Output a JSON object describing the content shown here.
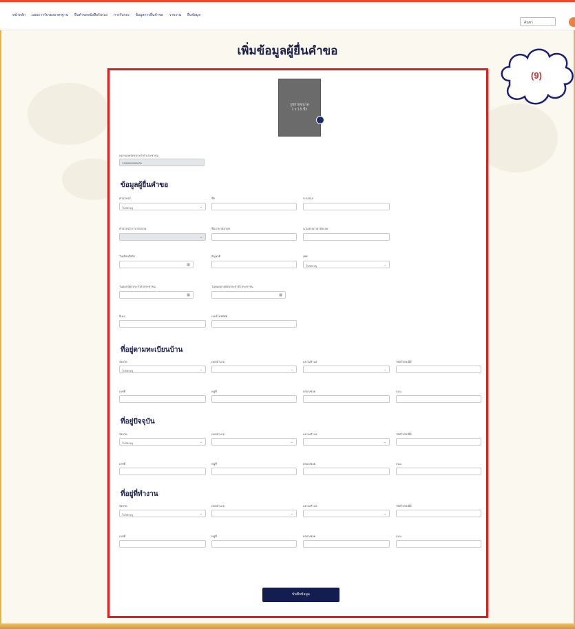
{
  "nav": {
    "items": [
      "หน้าหลัก",
      "แผนการรับรองมาตรฐาน",
      "ยื่นคำขอหนังสือรับรอง",
      "การรับรอง",
      "ข้อมูลการยื่นคำขอ",
      "รายงาน",
      "ยื่นข้อมูล"
    ],
    "search_placeholder": "ค้นหา"
  },
  "page_title": "เพิ่มข้อมูลผู้ยื่นคำขอ",
  "annotation_label": "(9)",
  "photo": {
    "caption_line1": "รูปถ่ายขนาด",
    "caption_line2": "1 x 1.5 นิ้ว"
  },
  "id_field": {
    "label": "หมายเลขบัตรประจำตัวประชาชน",
    "value": "1330000000000"
  },
  "applicant": {
    "title": "ข้อมูลผู้ยื่นคำขอ",
    "prefix_label": "คำนำหน้า",
    "prefix_value": "โปรดระบุ",
    "firstname_label": "ชื่อ",
    "lastname_label": "นามสกุล",
    "prefix_en_label": "คำนำหน้าภาษาอังกฤษ",
    "firstname_en_label": "ชื่อภาษาอังกฤษ",
    "lastname_en_label": "นามสกุลภาษาอังกฤษ",
    "birthdate_label": "วันเดือนปีเกิด",
    "nationality_label": "สัญชาติ",
    "gender_label": "เพศ",
    "gender_value": "โปรดระบุ",
    "issue_date_label": "วันออกบัตรประจำตัวประชาชน",
    "expire_date_label": "วันหมดอายุบัตรประจำตัวประชาชน",
    "email_label": "อีเมล",
    "phone_label": "เบอร์โทรศัพท์"
  },
  "addresses": [
    {
      "title": "ที่อยู่ตามทะเบียนบ้าน"
    },
    {
      "title": "ที่อยู่ปัจจุบัน"
    },
    {
      "title": "ที่อยู่ที่ทำงาน"
    }
  ],
  "address_fields": {
    "province_label": "จังหวัด",
    "province_value": "โปรดระบุ",
    "district_label": "เขต/อำเภอ",
    "subdistrict_label": "แขวง/ตำบล",
    "postcode_label": "รหัสไปรษณีย์",
    "house_no_label": "เลขที่",
    "moo_label": "หมู่ที่",
    "soi_label": "ตรอก/ซอย",
    "road_label": "ถนน"
  },
  "save_button": "บันทึกข้อมูล",
  "colors": {
    "accent_red": "#e21b1b",
    "navy": "#141d4f",
    "gold": "#e6b24a"
  }
}
